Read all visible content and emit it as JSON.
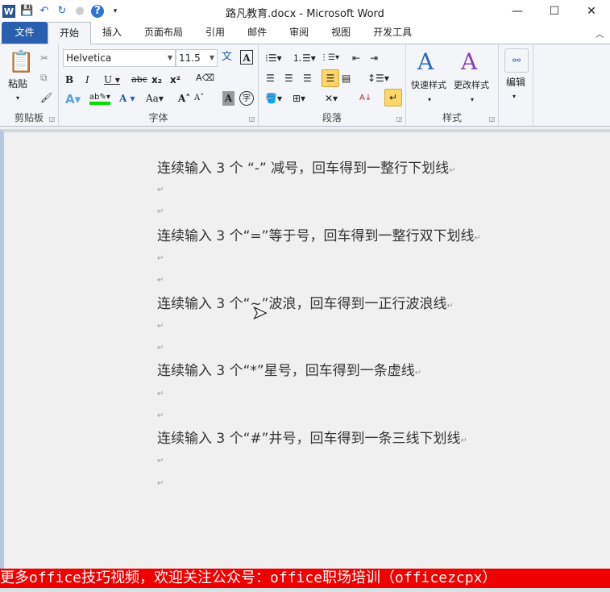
{
  "titlebar": {
    "title": "路凡教育.docx - Microsoft Word",
    "app_icon": "W",
    "minimize": "—",
    "maximize": "☐",
    "close": "✕"
  },
  "tabs": [
    "文件",
    "开始",
    "插入",
    "页面布局",
    "引用",
    "邮件",
    "审阅",
    "视图",
    "开发工具"
  ],
  "active_tab": "开始",
  "ribbon": {
    "clipboard": {
      "label": "剪贴板",
      "paste": "粘贴"
    },
    "font": {
      "label": "字体",
      "font_name": "Helvetica",
      "font_size": "11.5"
    },
    "paragraph": {
      "label": "段落"
    },
    "styles": {
      "label": "样式",
      "quick_styles": "快速样式",
      "change_styles": "更改样式"
    },
    "editing": {
      "label": "编辑"
    }
  },
  "document": {
    "lines": [
      {
        "text": "连续输入 3 个 “-” 减号，回车得到一整行下划线"
      },
      {
        "text": ""
      },
      {
        "text": ""
      },
      {
        "text": "连续输入 3 个“=”等于号，回车得到一整行双下划线"
      },
      {
        "text": ""
      },
      {
        "text": ""
      },
      {
        "text": "连续输入 3 个“~”波浪，回车得到一正行波浪线"
      },
      {
        "text": ""
      },
      {
        "text": ""
      },
      {
        "text": "连续输入 3 个“*”星号，回车得到一条虚线"
      },
      {
        "text": ""
      },
      {
        "text": ""
      },
      {
        "text": "连续输入 3 个“#”井号，回车得到一条三线下划线"
      },
      {
        "text": ""
      },
      {
        "text": ""
      }
    ],
    "paragraph_mark": "↵"
  },
  "banner": {
    "text": "更多office技巧视频，欢迎关注公众号：office职场培训（officezcpx）",
    "color": "#ee0000"
  }
}
